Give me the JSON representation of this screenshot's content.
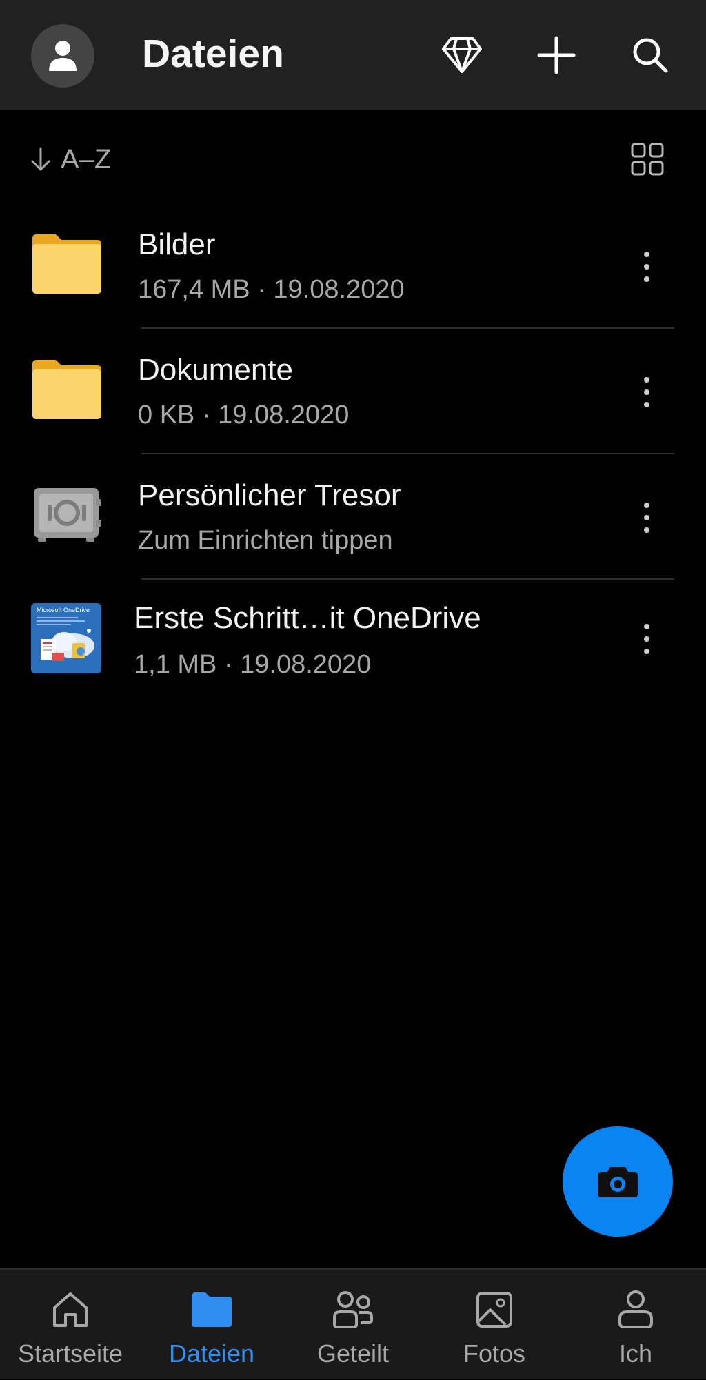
{
  "header": {
    "title": "Dateien",
    "icons": [
      "user-icon",
      "diamond-icon",
      "plus-icon",
      "search-icon"
    ]
  },
  "toolbar": {
    "sort_label": "A–Z",
    "sort_icon": "arrow-down-icon",
    "view_icon": "grid-view-icon"
  },
  "files": [
    {
      "name": "Bilder",
      "meta": "167,4 MB · 19.08.2020",
      "icon": "folder-icon"
    },
    {
      "name": "Dokumente",
      "meta": "0 KB · 19.08.2020",
      "icon": "folder-icon"
    },
    {
      "name": "Persönlicher Tresor",
      "meta": "Zum Einrichten tippen",
      "icon": "vault-icon"
    },
    {
      "name": "Erste Schritt…it OneDrive",
      "meta": "1,1 MB · 19.08.2020",
      "icon": "document-thumbnail",
      "thumbnail_text": "Microsoft OneDrive"
    }
  ],
  "fab": {
    "icon": "camera-icon"
  },
  "bottom_nav": {
    "items": [
      {
        "label": "Startseite",
        "icon": "home-icon",
        "active": false
      },
      {
        "label": "Dateien",
        "icon": "folder-icon",
        "active": true
      },
      {
        "label": "Geteilt",
        "icon": "people-icon",
        "active": false
      },
      {
        "label": "Fotos",
        "icon": "photo-icon",
        "active": false
      },
      {
        "label": "Ich",
        "icon": "person-icon",
        "active": false
      }
    ]
  },
  "colors": {
    "accent": "#0a84f0",
    "active_nav": "#2f8ef0",
    "folder": "#fbd56b",
    "background": "#000000",
    "header_bg": "#212121"
  }
}
